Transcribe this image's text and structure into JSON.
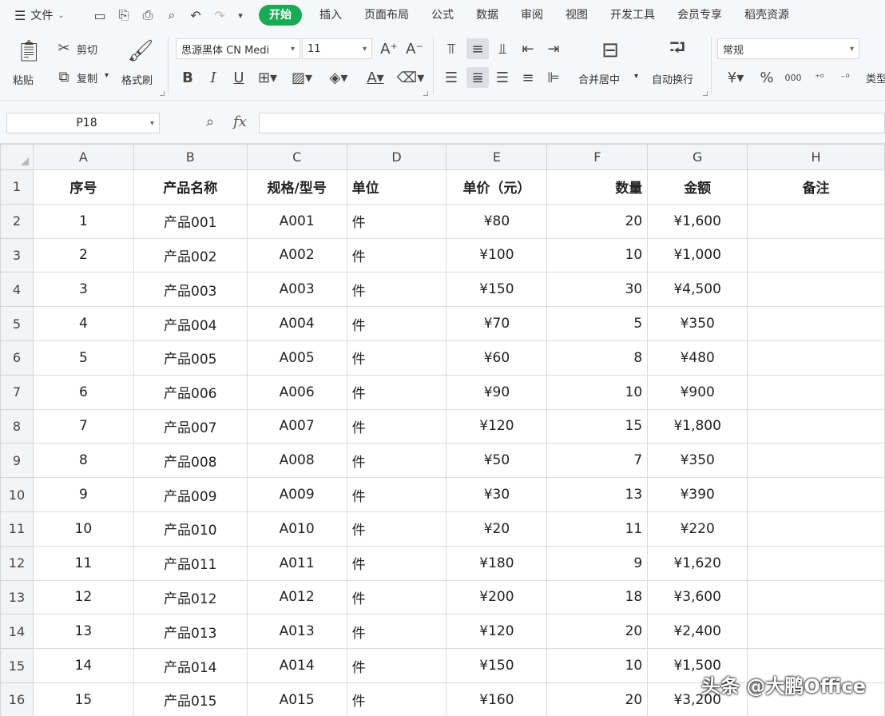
{
  "menubar": {
    "file_label": "文件",
    "tabs": [
      {
        "label": "开始",
        "active": true
      },
      {
        "label": "插入"
      },
      {
        "label": "页面布局"
      },
      {
        "label": "公式"
      },
      {
        "label": "数据"
      },
      {
        "label": "审阅"
      },
      {
        "label": "视图"
      },
      {
        "label": "开发工具"
      },
      {
        "label": "会员专享"
      },
      {
        "label": "稻壳资源"
      }
    ]
  },
  "ribbon": {
    "paste": "粘贴",
    "cut": "剪切",
    "copy": "复制",
    "format_painter": "格式刷",
    "font_name": "思源黑体 CN Medi",
    "font_size": "11",
    "bold": "B",
    "italic": "I",
    "underline": "U",
    "font_color_glyph": "A",
    "merge_center": "合并居中",
    "wrap_text": "自动换行",
    "number_format": "常规",
    "currency_glyph": "¥",
    "percent_glyph": "%",
    "thousands_glyph": "000",
    "cell_type": "类型"
  },
  "formula_bar": {
    "name_box": "P18",
    "fx": "fx",
    "formula": ""
  },
  "sheet": {
    "columns": [
      "A",
      "B",
      "C",
      "D",
      "E",
      "F",
      "G",
      "H"
    ],
    "header_row": {
      "row": "1",
      "cells": [
        "序号",
        "产品名称",
        "规格/型号",
        "单位",
        "单价（元）",
        "数量",
        "金额",
        "备注"
      ]
    },
    "rows": [
      {
        "row": "2",
        "cells": [
          "1",
          "产品001",
          "A001",
          "件",
          "¥80",
          "20",
          "¥1,600",
          ""
        ]
      },
      {
        "row": "3",
        "cells": [
          "2",
          "产品002",
          "A002",
          "件",
          "¥100",
          "10",
          "¥1,000",
          ""
        ]
      },
      {
        "row": "4",
        "cells": [
          "3",
          "产品003",
          "A003",
          "件",
          "¥150",
          "30",
          "¥4,500",
          ""
        ]
      },
      {
        "row": "5",
        "cells": [
          "4",
          "产品004",
          "A004",
          "件",
          "¥70",
          "5",
          "¥350",
          ""
        ]
      },
      {
        "row": "6",
        "cells": [
          "5",
          "产品005",
          "A005",
          "件",
          "¥60",
          "8",
          "¥480",
          ""
        ]
      },
      {
        "row": "7",
        "cells": [
          "6",
          "产品006",
          "A006",
          "件",
          "¥90",
          "10",
          "¥900",
          ""
        ]
      },
      {
        "row": "8",
        "cells": [
          "7",
          "产品007",
          "A007",
          "件",
          "¥120",
          "15",
          "¥1,800",
          ""
        ]
      },
      {
        "row": "9",
        "cells": [
          "8",
          "产品008",
          "A008",
          "件",
          "¥50",
          "7",
          "¥350",
          ""
        ]
      },
      {
        "row": "10",
        "cells": [
          "9",
          "产品009",
          "A009",
          "件",
          "¥30",
          "13",
          "¥390",
          ""
        ]
      },
      {
        "row": "11",
        "cells": [
          "10",
          "产品010",
          "A010",
          "件",
          "¥20",
          "11",
          "¥220",
          ""
        ]
      },
      {
        "row": "12",
        "cells": [
          "11",
          "产品011",
          "A011",
          "件",
          "¥180",
          "9",
          "¥1,620",
          ""
        ]
      },
      {
        "row": "13",
        "cells": [
          "12",
          "产品012",
          "A012",
          "件",
          "¥200",
          "18",
          "¥3,600",
          ""
        ]
      },
      {
        "row": "14",
        "cells": [
          "13",
          "产品013",
          "A013",
          "件",
          "¥120",
          "20",
          "¥2,400",
          ""
        ]
      },
      {
        "row": "15",
        "cells": [
          "14",
          "产品014",
          "A014",
          "件",
          "¥150",
          "10",
          "¥1,500",
          ""
        ]
      },
      {
        "row": "16",
        "cells": [
          "15",
          "产品015",
          "A015",
          "件",
          "¥160",
          "20",
          "¥3,200",
          ""
        ]
      }
    ]
  },
  "watermark": "头条 @大鹏Office"
}
